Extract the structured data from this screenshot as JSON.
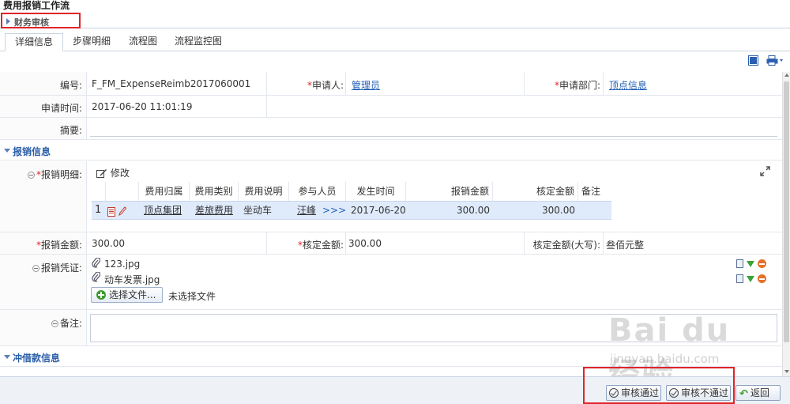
{
  "window": {
    "title": "费用报销工作流"
  },
  "step": {
    "label": "财务审核"
  },
  "tabs": [
    {
      "label": "详细信息",
      "active": true
    },
    {
      "label": "步骤明细"
    },
    {
      "label": "流程图"
    },
    {
      "label": "流程监控图"
    }
  ],
  "toolbar": {
    "icons": [
      "window-icon",
      "print-icon"
    ]
  },
  "form": {
    "code_label": "编号:",
    "code_value": "F_FM_ExpenseReimb2017060001",
    "applicant_label": "申请人:",
    "applicant_value": "管理员",
    "dept_label": "申请部门:",
    "dept_value": "顶点信息",
    "apply_time_label": "申请时间:",
    "apply_time_value": "2017-06-20 11:01:19",
    "summary_label": "摘要:",
    "summary_value": "",
    "required_mark": "*"
  },
  "section_expense": {
    "title": "报销信息"
  },
  "detail": {
    "label": "报销明细:",
    "edit_label": "修改",
    "columns": [
      "费用归属",
      "费用类别",
      "费用说明",
      "参与人员",
      "发生时间",
      "报销金额",
      "核定金额",
      "备注"
    ],
    "rows": [
      {
        "index": "1",
        "owner": "顶点集团",
        "category": "差旅费用",
        "desc": "坐动车",
        "people": "汪峰",
        "more": ">>>",
        "date": "2017-06-20",
        "amount": "300.00",
        "approved": "300.00",
        "note": ""
      }
    ]
  },
  "amounts": {
    "amount_label": "报销金额:",
    "amount_value": "300.00",
    "approved_label": "核定金额:",
    "approved_value": "300.00",
    "approved_cn_label": "核定金额(大写):",
    "approved_cn_value": "叁佰元整"
  },
  "attachments": {
    "label": "报销凭证:",
    "files": [
      "123.jpg",
      "动车发票.jpg"
    ],
    "choose_button": "选择文件...",
    "no_file_text": "未选择文件"
  },
  "remark": {
    "label": "备注:",
    "value": ""
  },
  "section_loan": {
    "title": "冲借款信息"
  },
  "buttons": {
    "approve": "审核通过",
    "reject": "审核不通过",
    "back": "返回"
  },
  "watermark": {
    "main": "Bai du 经验",
    "sub": "jingyan.baidu.com"
  }
}
